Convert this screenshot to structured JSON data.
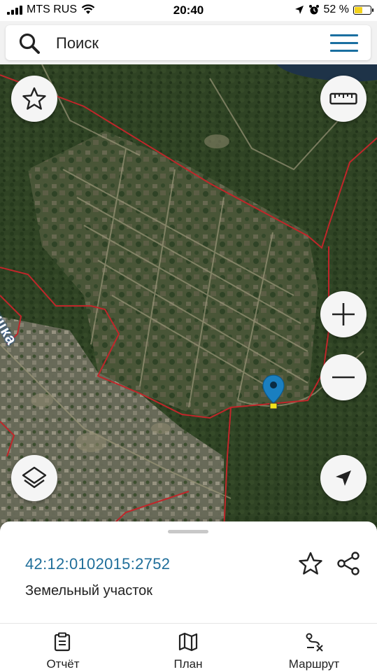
{
  "status_bar": {
    "carrier": "MTS RUS",
    "time": "20:40",
    "battery_percent": "52 %",
    "battery_level": 0.52,
    "battery_color": "#f3d21c"
  },
  "search": {
    "placeholder": "Поиск"
  },
  "map": {
    "place_label": "нушка",
    "boundary_color": "#c0262a",
    "marker_color": "#1a7fc0",
    "marker_pin_color": "#f2e21a",
    "controls": {
      "favorite": "star-icon",
      "ruler": "ruler-icon",
      "zoom_in": "plus-icon",
      "zoom_out": "minus-icon",
      "layers": "layers-icon",
      "locate": "navigation-arrow-icon"
    }
  },
  "parcel": {
    "cadastral_number": "42:12:0102015:2752",
    "type": "Земельный участок",
    "number_color": "#1f6e9a"
  },
  "tabs": [
    {
      "label": "Отчёт",
      "icon": "clipboard-icon"
    },
    {
      "label": "План",
      "icon": "map-icon"
    },
    {
      "label": "Маршрут",
      "icon": "route-icon"
    }
  ]
}
